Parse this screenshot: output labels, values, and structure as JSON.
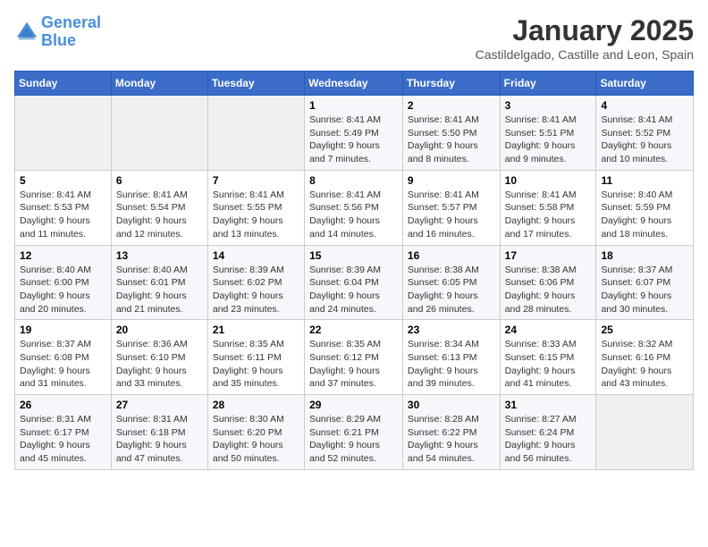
{
  "logo": {
    "line1": "General",
    "line2": "Blue"
  },
  "title": "January 2025",
  "subtitle": "Castildelgado, Castille and Leon, Spain",
  "days_of_week": [
    "Sunday",
    "Monday",
    "Tuesday",
    "Wednesday",
    "Thursday",
    "Friday",
    "Saturday"
  ],
  "weeks": [
    [
      {
        "day": "",
        "info": ""
      },
      {
        "day": "",
        "info": ""
      },
      {
        "day": "",
        "info": ""
      },
      {
        "day": "1",
        "info": "Sunrise: 8:41 AM\nSunset: 5:49 PM\nDaylight: 9 hours and 7 minutes."
      },
      {
        "day": "2",
        "info": "Sunrise: 8:41 AM\nSunset: 5:50 PM\nDaylight: 9 hours and 8 minutes."
      },
      {
        "day": "3",
        "info": "Sunrise: 8:41 AM\nSunset: 5:51 PM\nDaylight: 9 hours and 9 minutes."
      },
      {
        "day": "4",
        "info": "Sunrise: 8:41 AM\nSunset: 5:52 PM\nDaylight: 9 hours and 10 minutes."
      }
    ],
    [
      {
        "day": "5",
        "info": "Sunrise: 8:41 AM\nSunset: 5:53 PM\nDaylight: 9 hours and 11 minutes."
      },
      {
        "day": "6",
        "info": "Sunrise: 8:41 AM\nSunset: 5:54 PM\nDaylight: 9 hours and 12 minutes."
      },
      {
        "day": "7",
        "info": "Sunrise: 8:41 AM\nSunset: 5:55 PM\nDaylight: 9 hours and 13 minutes."
      },
      {
        "day": "8",
        "info": "Sunrise: 8:41 AM\nSunset: 5:56 PM\nDaylight: 9 hours and 14 minutes."
      },
      {
        "day": "9",
        "info": "Sunrise: 8:41 AM\nSunset: 5:57 PM\nDaylight: 9 hours and 16 minutes."
      },
      {
        "day": "10",
        "info": "Sunrise: 8:41 AM\nSunset: 5:58 PM\nDaylight: 9 hours and 17 minutes."
      },
      {
        "day": "11",
        "info": "Sunrise: 8:40 AM\nSunset: 5:59 PM\nDaylight: 9 hours and 18 minutes."
      }
    ],
    [
      {
        "day": "12",
        "info": "Sunrise: 8:40 AM\nSunset: 6:00 PM\nDaylight: 9 hours and 20 minutes."
      },
      {
        "day": "13",
        "info": "Sunrise: 8:40 AM\nSunset: 6:01 PM\nDaylight: 9 hours and 21 minutes."
      },
      {
        "day": "14",
        "info": "Sunrise: 8:39 AM\nSunset: 6:02 PM\nDaylight: 9 hours and 23 minutes."
      },
      {
        "day": "15",
        "info": "Sunrise: 8:39 AM\nSunset: 6:04 PM\nDaylight: 9 hours and 24 minutes."
      },
      {
        "day": "16",
        "info": "Sunrise: 8:38 AM\nSunset: 6:05 PM\nDaylight: 9 hours and 26 minutes."
      },
      {
        "day": "17",
        "info": "Sunrise: 8:38 AM\nSunset: 6:06 PM\nDaylight: 9 hours and 28 minutes."
      },
      {
        "day": "18",
        "info": "Sunrise: 8:37 AM\nSunset: 6:07 PM\nDaylight: 9 hours and 30 minutes."
      }
    ],
    [
      {
        "day": "19",
        "info": "Sunrise: 8:37 AM\nSunset: 6:08 PM\nDaylight: 9 hours and 31 minutes."
      },
      {
        "day": "20",
        "info": "Sunrise: 8:36 AM\nSunset: 6:10 PM\nDaylight: 9 hours and 33 minutes."
      },
      {
        "day": "21",
        "info": "Sunrise: 8:35 AM\nSunset: 6:11 PM\nDaylight: 9 hours and 35 minutes."
      },
      {
        "day": "22",
        "info": "Sunrise: 8:35 AM\nSunset: 6:12 PM\nDaylight: 9 hours and 37 minutes."
      },
      {
        "day": "23",
        "info": "Sunrise: 8:34 AM\nSunset: 6:13 PM\nDaylight: 9 hours and 39 minutes."
      },
      {
        "day": "24",
        "info": "Sunrise: 8:33 AM\nSunset: 6:15 PM\nDaylight: 9 hours and 41 minutes."
      },
      {
        "day": "25",
        "info": "Sunrise: 8:32 AM\nSunset: 6:16 PM\nDaylight: 9 hours and 43 minutes."
      }
    ],
    [
      {
        "day": "26",
        "info": "Sunrise: 8:31 AM\nSunset: 6:17 PM\nDaylight: 9 hours and 45 minutes."
      },
      {
        "day": "27",
        "info": "Sunrise: 8:31 AM\nSunset: 6:18 PM\nDaylight: 9 hours and 47 minutes."
      },
      {
        "day": "28",
        "info": "Sunrise: 8:30 AM\nSunset: 6:20 PM\nDaylight: 9 hours and 50 minutes."
      },
      {
        "day": "29",
        "info": "Sunrise: 8:29 AM\nSunset: 6:21 PM\nDaylight: 9 hours and 52 minutes."
      },
      {
        "day": "30",
        "info": "Sunrise: 8:28 AM\nSunset: 6:22 PM\nDaylight: 9 hours and 54 minutes."
      },
      {
        "day": "31",
        "info": "Sunrise: 8:27 AM\nSunset: 6:24 PM\nDaylight: 9 hours and 56 minutes."
      },
      {
        "day": "",
        "info": ""
      }
    ]
  ]
}
